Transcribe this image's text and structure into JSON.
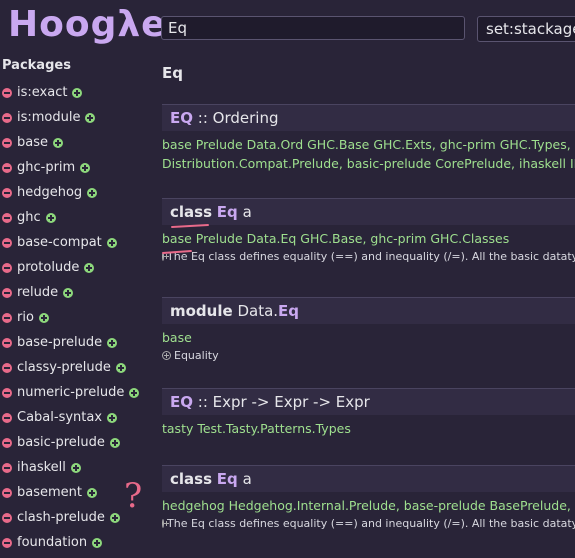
{
  "logo": "Hoogλe",
  "search": {
    "query": "Eq",
    "scope": "set:stackage"
  },
  "sidebar": {
    "heading": "Packages",
    "items": [
      {
        "label": "is:exact"
      },
      {
        "label": "is:module"
      },
      {
        "label": "base"
      },
      {
        "label": "ghc-prim"
      },
      {
        "label": "hedgehog"
      },
      {
        "label": "ghc"
      },
      {
        "label": "base-compat"
      },
      {
        "label": "protolude"
      },
      {
        "label": "relude"
      },
      {
        "label": "rio"
      },
      {
        "label": "base-prelude"
      },
      {
        "label": "classy-prelude"
      },
      {
        "label": "numeric-prelude"
      },
      {
        "label": "Cabal-syntax"
      },
      {
        "label": "basic-prelude"
      },
      {
        "label": "ihaskell"
      },
      {
        "label": "basement"
      },
      {
        "label": "clash-prelude"
      },
      {
        "label": "foundation"
      }
    ]
  },
  "query_title": "Eq",
  "results": [
    {
      "name": "EQ",
      "rest": ":: Ordering",
      "pkg1": "base Prelude Data.Ord GHC.Base GHC.Exts, ghc-prim GHC.Types, hedgehog",
      "pkg2": "Distribution.Compat.Prelude, basic-prelude CorePrelude, ihaskell IHaskell"
    },
    {
      "kw": "class",
      "name": "Eq",
      "rest": "a",
      "pkg1": "base Prelude Data.Eq GHC.Base, ghc-prim GHC.Classes",
      "doc": "The Eq class defines equality (==) and inequality (/=). All the basic datatypes exported by"
    },
    {
      "kw": "module",
      "kwpre": "Data.",
      "name": "Eq",
      "pkg1": "base",
      "doc": "Equality"
    },
    {
      "name": "EQ",
      "rest": ":: Expr -> Expr -> Expr",
      "pkg1": "tasty Test.Tasty.Patterns.Types"
    },
    {
      "kw": "class",
      "name": "Eq",
      "rest": "a",
      "pkg1": "hedgehog Hedgehog.Internal.Prelude, base-prelude BasePrelude, classy",
      "doc": "The Eq class defines equality (==) and inequality (/=). All the basic datatypes exported by"
    }
  ],
  "annotation": "?"
}
